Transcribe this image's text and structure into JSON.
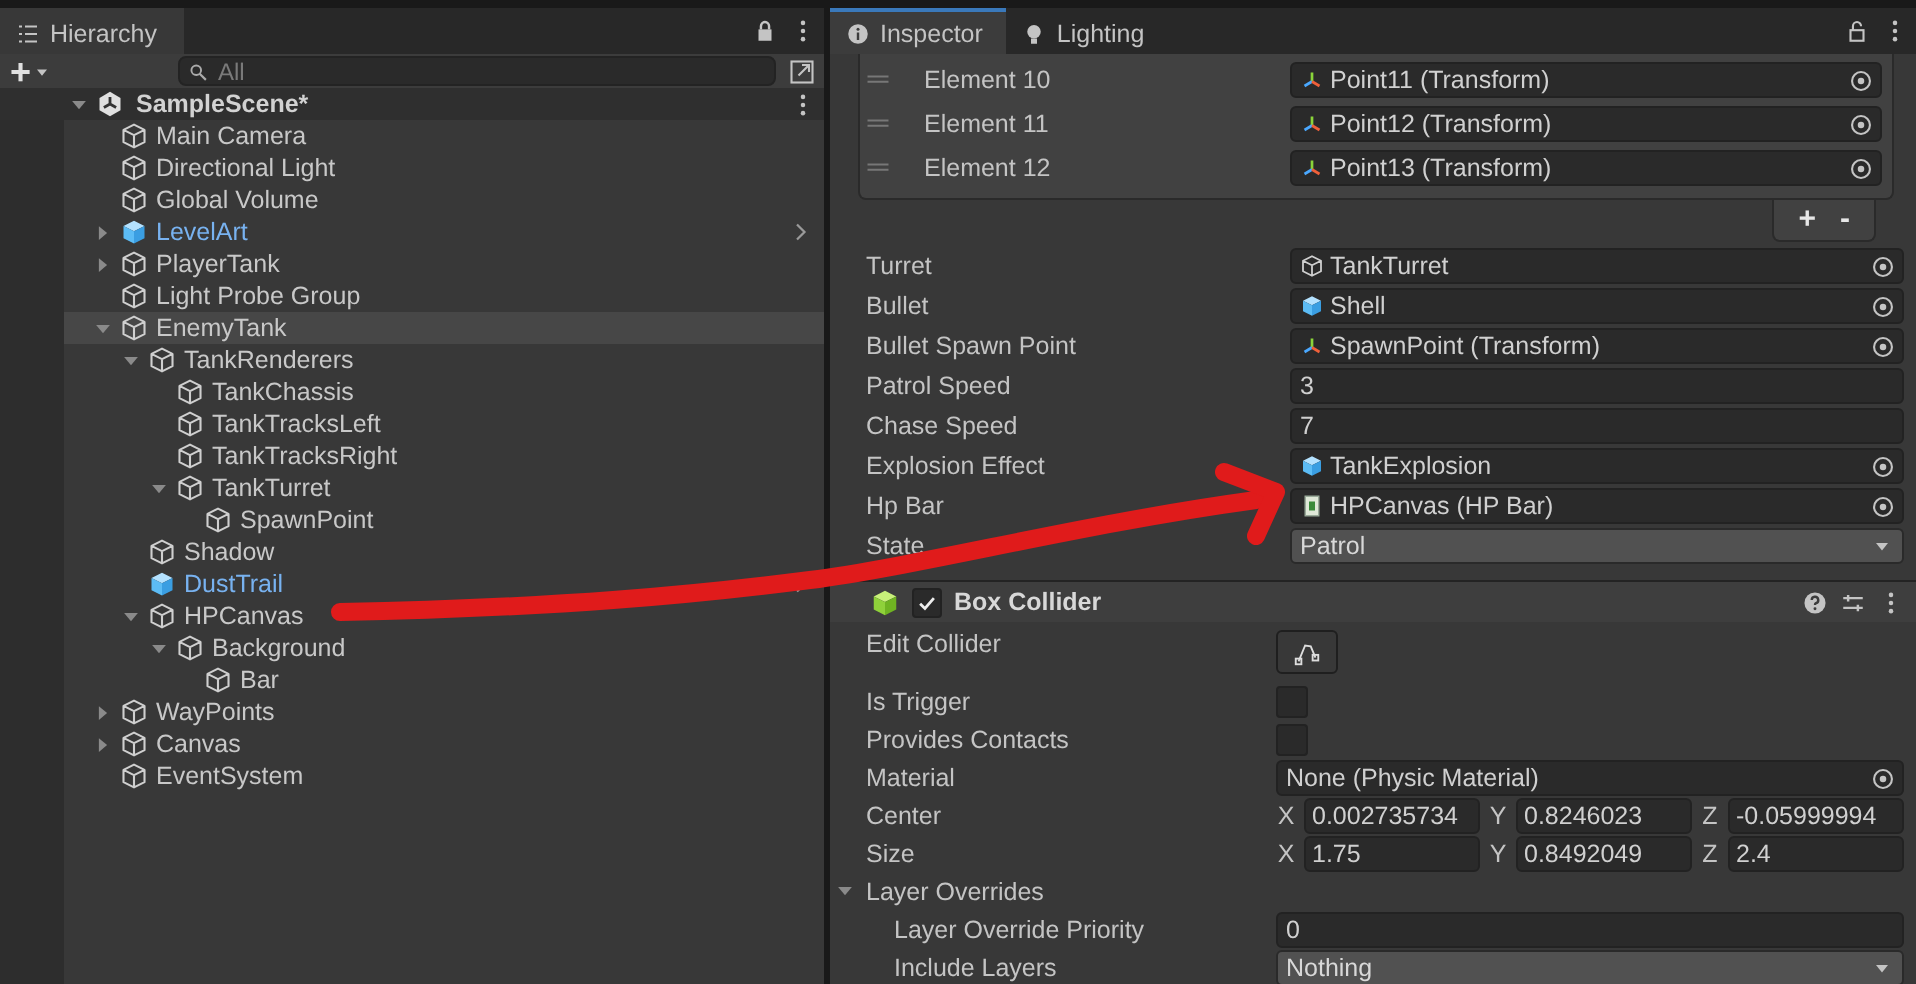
{
  "hierarchy": {
    "tab": "Hierarchy",
    "add_label": "+",
    "search": {
      "placeholder": "All"
    },
    "scene": {
      "name": "SampleScene*",
      "expanded": true
    },
    "items": [
      {
        "name": "Main Camera",
        "prefab": false,
        "selected": false
      },
      {
        "name": "Directional Light",
        "prefab": false,
        "selected": false
      },
      {
        "name": "Global Volume",
        "prefab": false,
        "selected": false
      },
      {
        "name": "LevelArt",
        "prefab": true,
        "selected": false,
        "expanded": false
      },
      {
        "name": "PlayerTank",
        "prefab": false,
        "selected": false,
        "expanded": false
      },
      {
        "name": "Light Probe Group",
        "prefab": false,
        "selected": false
      },
      {
        "name": "EnemyTank",
        "prefab": false,
        "selected": true,
        "expanded": true,
        "children": [
          {
            "name": "TankRenderers",
            "prefab": false,
            "selected": false,
            "expanded": true,
            "children": [
              {
                "name": "TankChassis",
                "prefab": false,
                "selected": false
              },
              {
                "name": "TankTracksLeft",
                "prefab": false,
                "selected": false
              },
              {
                "name": "TankTracksRight",
                "prefab": false,
                "selected": false
              },
              {
                "name": "TankTurret",
                "prefab": false,
                "selected": false,
                "expanded": true,
                "children": [
                  {
                    "name": "SpawnPoint",
                    "prefab": false,
                    "selected": false
                  }
                ]
              }
            ]
          },
          {
            "name": "Shadow",
            "prefab": false,
            "selected": false
          },
          {
            "name": "DustTrail",
            "prefab": true,
            "selected": false
          },
          {
            "name": "HPCanvas",
            "prefab": false,
            "selected": false,
            "expanded": true,
            "children": [
              {
                "name": "Background",
                "prefab": false,
                "selected": false,
                "expanded": true,
                "children": [
                  {
                    "name": "Bar",
                    "prefab": false,
                    "selected": false
                  }
                ]
              }
            ]
          }
        ]
      },
      {
        "name": "WayPoints",
        "prefab": false,
        "selected": false,
        "expanded": false
      },
      {
        "name": "Canvas",
        "prefab": false,
        "selected": false,
        "expanded": false
      },
      {
        "name": "EventSystem",
        "prefab": false,
        "selected": false
      }
    ]
  },
  "inspector": {
    "tabs": [
      {
        "label": "Inspector",
        "selected": true
      },
      {
        "label": "Lighting",
        "selected": false
      }
    ],
    "array_elements": [
      {
        "label": "Element 10",
        "value": "Point11 (Transform)"
      },
      {
        "label": "Element 11",
        "value": "Point12 (Transform)"
      },
      {
        "label": "Element 12",
        "value": "Point13 (Transform)"
      }
    ],
    "array_buttons": [
      "+",
      "-"
    ],
    "fields": [
      {
        "label": "Turret",
        "kind": "gameobject",
        "value": "TankTurret"
      },
      {
        "label": "Bullet",
        "kind": "prefab",
        "value": "Shell"
      },
      {
        "label": "Bullet Spawn Point",
        "kind": "transform",
        "value": "SpawnPoint (Transform)"
      },
      {
        "label": "Patrol Speed",
        "kind": "text",
        "value": "3"
      },
      {
        "label": "Chase Speed",
        "kind": "text",
        "value": "7"
      },
      {
        "label": "Explosion Effect",
        "kind": "prefab",
        "value": "TankExplosion"
      },
      {
        "label": "Hp Bar",
        "kind": "script",
        "value": "HPCanvas (HP Bar)"
      },
      {
        "label": "State",
        "kind": "dropdown",
        "value": "Patrol"
      }
    ],
    "component": {
      "title": "Box Collider",
      "enabled": true,
      "fields": [
        {
          "label": "Edit Collider",
          "kind": "edit_button"
        },
        {
          "label": "Is Trigger",
          "kind": "checkbox",
          "checked": false
        },
        {
          "label": "Provides Contacts",
          "kind": "checkbox",
          "checked": false
        },
        {
          "label": "Material",
          "kind": "object",
          "value": "None (Physic Material)"
        },
        {
          "label": "Center",
          "kind": "vector3",
          "values": [
            {
              "axis": "X",
              "value": "0.002735734"
            },
            {
              "axis": "Y",
              "value": "0.8246023"
            },
            {
              "axis": "Z",
              "value": "-0.05999994"
            }
          ]
        },
        {
          "label": "Size",
          "kind": "vector3",
          "values": [
            {
              "axis": "X",
              "value": "1.75"
            },
            {
              "axis": "Y",
              "value": "0.8492049"
            },
            {
              "axis": "Z",
              "value": "2.4"
            }
          ]
        },
        {
          "label": "Layer Overrides",
          "kind": "foldout",
          "expanded": true,
          "children": [
            {
              "label": "Layer Override Priority",
              "kind": "text",
              "value": "0"
            },
            {
              "label": "Include Layers",
              "kind": "dropdown",
              "value": "Nothing"
            }
          ]
        }
      ]
    }
  }
}
